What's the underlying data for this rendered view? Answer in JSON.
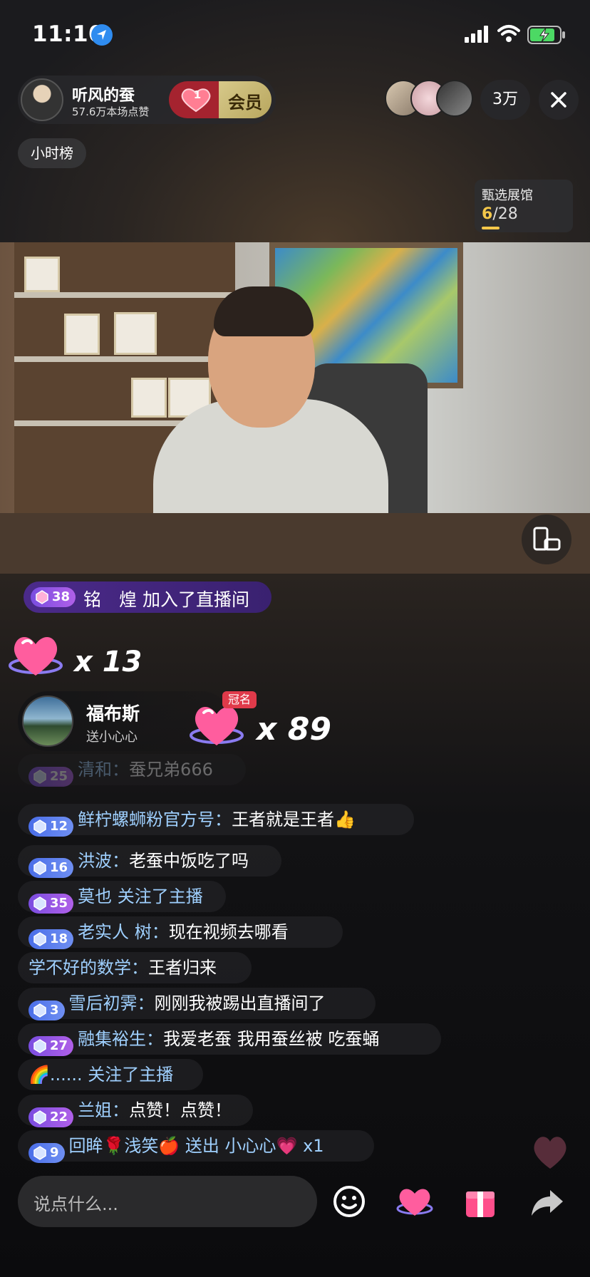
{
  "status_bar": {
    "time": "11:10"
  },
  "host": {
    "name": "听风的蚕",
    "likes": "57.6万本场点赞",
    "heart_level": "1",
    "member_label": "会员"
  },
  "viewers": {
    "count": "3万"
  },
  "rank_pill": "小时榜",
  "gallery": {
    "title": "甄选展馆",
    "current": "6",
    "total": "/28",
    "progress": 0.21
  },
  "join_banner": {
    "level": "38",
    "text": "铭　煌 加入了直播间"
  },
  "hearts": {
    "first_mult": "x 13",
    "second_mult": "x 89"
  },
  "gift": {
    "name": "福布斯",
    "sub": "送小心心",
    "tag": "冠名"
  },
  "chat": [
    {
      "level": "25",
      "badge": "purple",
      "user": "清和：",
      "msg": "蚕兄弟666",
      "faded": true
    },
    {
      "level": "12",
      "badge": "blue",
      "user": "鲜柠螺蛳粉官方号：",
      "msg": "王者就是王者👍"
    },
    {
      "level": "16",
      "badge": "blue",
      "user": "洪波：",
      "msg": "老蚕中饭吃了吗"
    },
    {
      "level": "35",
      "badge": "purple",
      "user": "莫也 关注了主播",
      "msg": ""
    },
    {
      "level": "18",
      "badge": "blue",
      "user": "老实人 树：",
      "msg": "现在视频去哪看"
    },
    {
      "level": "",
      "badge": "",
      "user": "学不好的数学：",
      "msg": "王者归来"
    },
    {
      "level": "3",
      "badge": "blue",
      "user": "雪后初霁：",
      "msg": "刚刚我被踢出直播间了"
    },
    {
      "level": "27",
      "badge": "purple",
      "user": "融集裕生：",
      "msg": "我爱老蚕  我用蚕丝被  吃蚕蛹"
    },
    {
      "level": "",
      "badge": "",
      "user": "🌈...... 关注了主播",
      "msg": ""
    },
    {
      "level": "22",
      "badge": "purple",
      "user": "兰姐：",
      "msg": "点赞！点赞！"
    },
    {
      "level": "9",
      "badge": "blue",
      "user": "回眸🌹浅笑🍎 送出 小心心💗 x1",
      "msg": ""
    }
  ],
  "input": {
    "placeholder": "说点什么..."
  },
  "icons": [
    "location-icon",
    "signal-icon",
    "wifi-icon",
    "battery-icon",
    "close-icon",
    "flip-screen-icon",
    "emoji-icon",
    "heart-gift-icon",
    "gift-box-icon",
    "share-icon"
  ]
}
